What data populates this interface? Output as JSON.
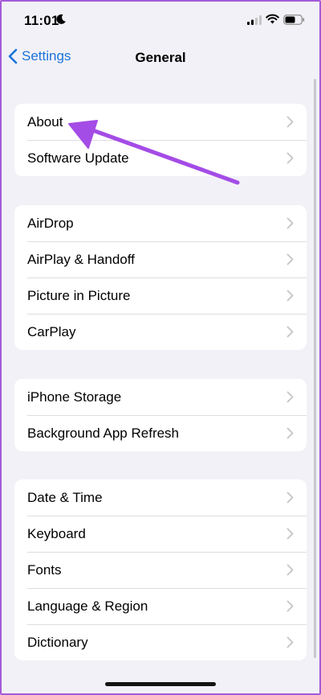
{
  "status_bar": {
    "time": "11:01",
    "icons": [
      "moon-icon",
      "cellular-signal-icon",
      "wifi-icon",
      "battery-icon"
    ]
  },
  "nav": {
    "back_label": "Settings",
    "title": "General",
    "accent_color": "#1a73d8"
  },
  "groups": [
    {
      "items": [
        {
          "label": "About"
        },
        {
          "label": "Software Update"
        }
      ]
    },
    {
      "items": [
        {
          "label": "AirDrop"
        },
        {
          "label": "AirPlay & Handoff"
        },
        {
          "label": "Picture in Picture"
        },
        {
          "label": "CarPlay"
        }
      ]
    },
    {
      "items": [
        {
          "label": "iPhone Storage"
        },
        {
          "label": "Background App Refresh"
        }
      ]
    },
    {
      "items": [
        {
          "label": "Date & Time"
        },
        {
          "label": "Keyboard"
        },
        {
          "label": "Fonts"
        },
        {
          "label": "Language & Region"
        },
        {
          "label": "Dictionary"
        }
      ]
    }
  ],
  "annotation": {
    "arrow_color": "#a44ce6",
    "points_to": "About"
  }
}
